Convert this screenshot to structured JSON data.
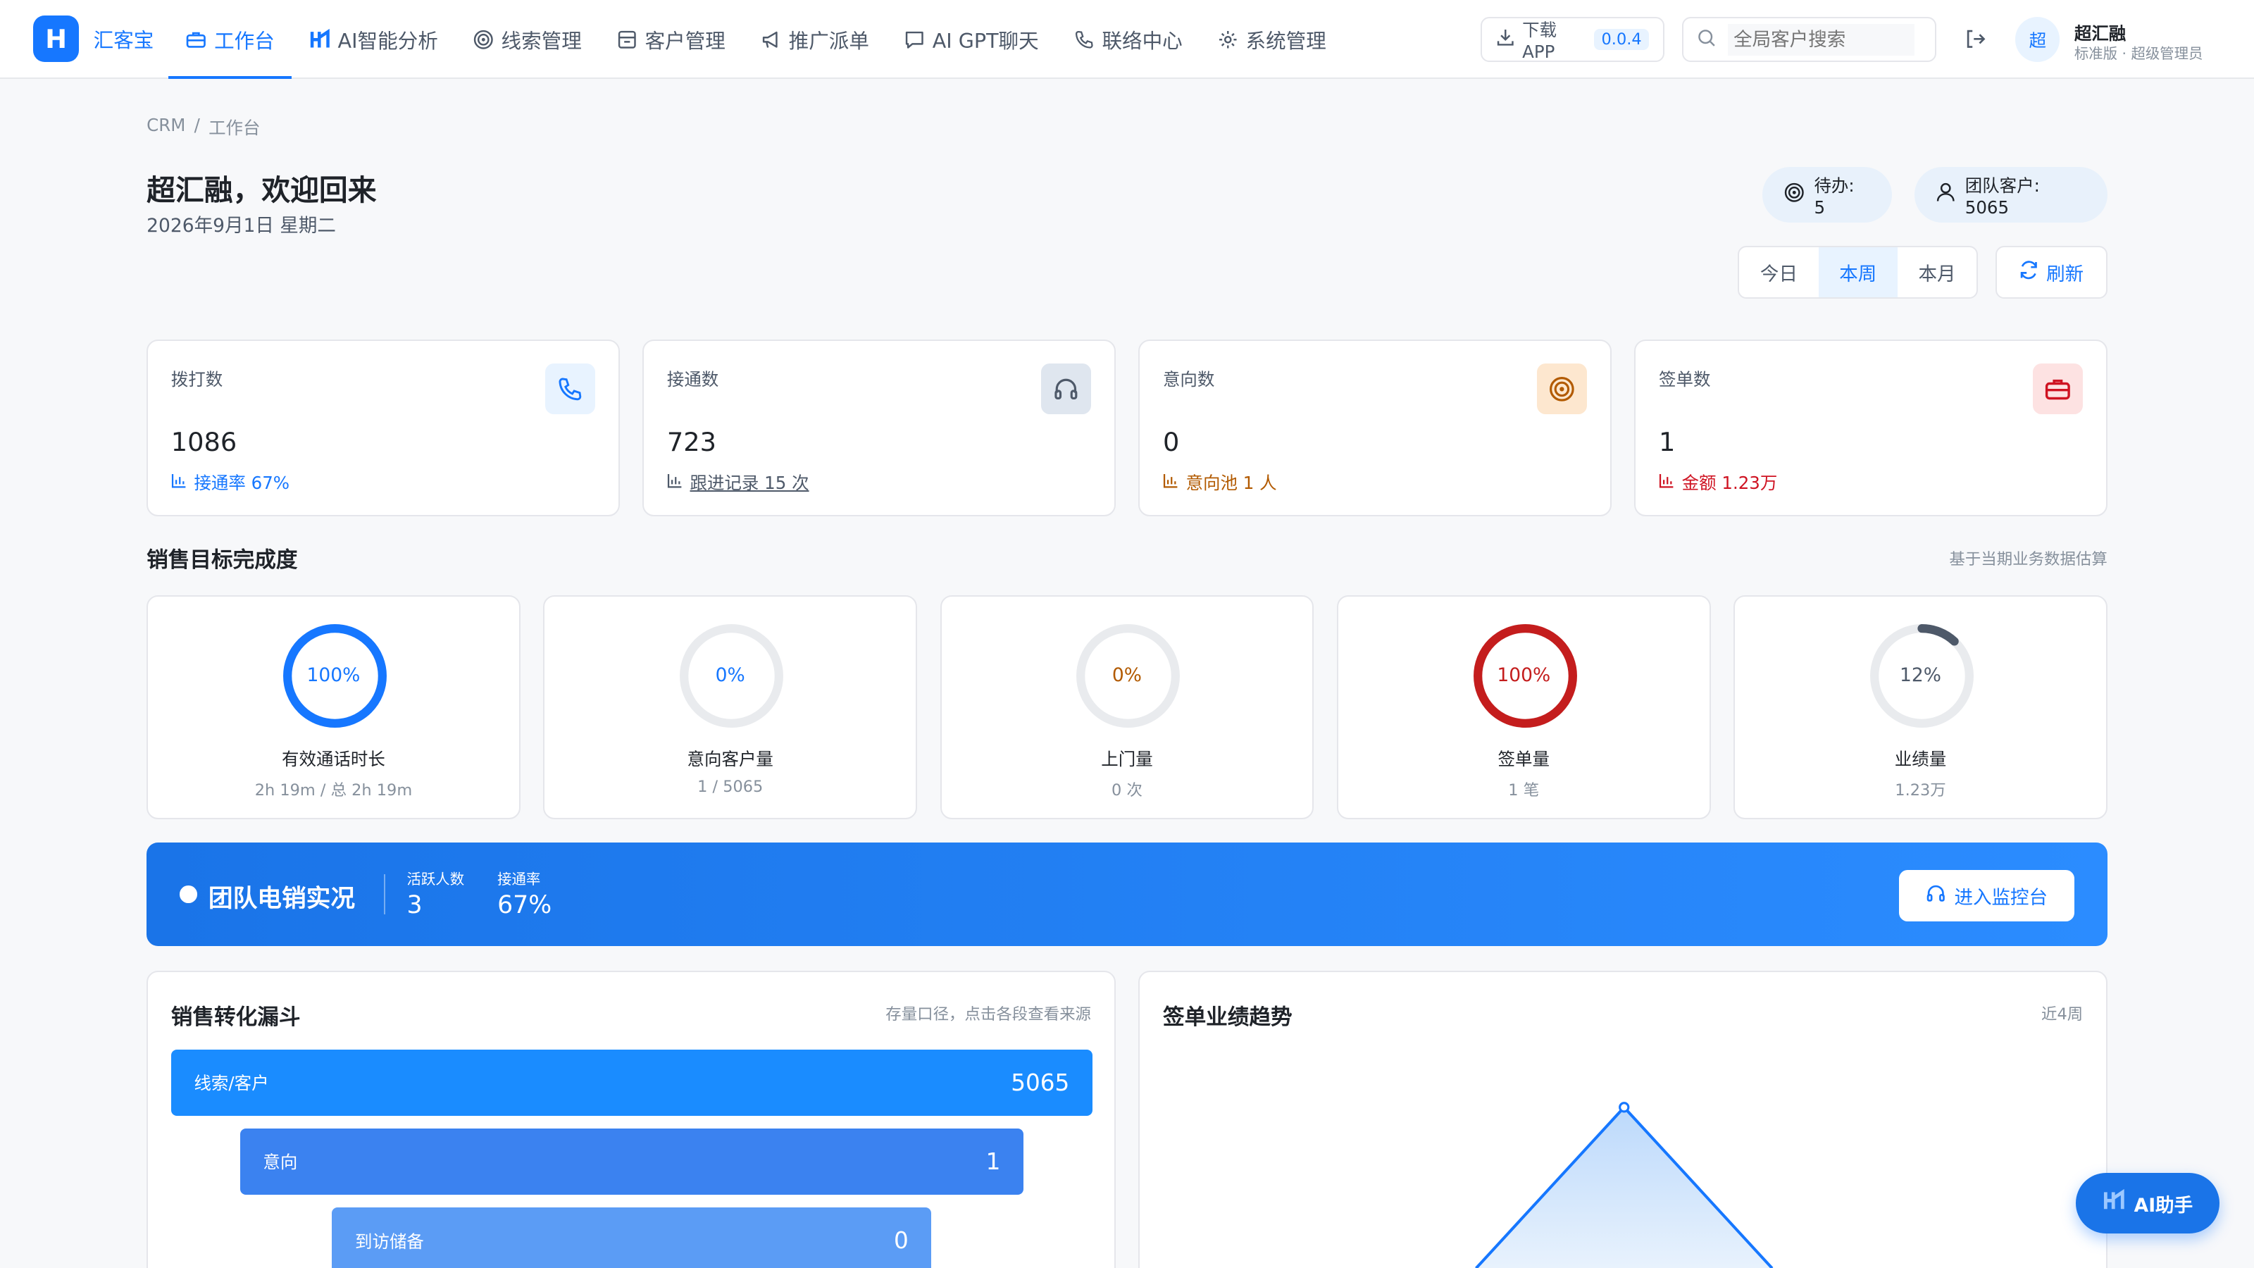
{
  "header": {
    "brand": "汇客宝",
    "logo_text": "H",
    "nav": [
      {
        "label": "工作台",
        "icon": "briefcase-icon"
      },
      {
        "label": "AI智能分析",
        "icon": "ai-logo-icon"
      },
      {
        "label": "线索管理",
        "icon": "target-icon"
      },
      {
        "label": "客户管理",
        "icon": "inbox-icon"
      },
      {
        "label": "推广派单",
        "icon": "megaphone-icon"
      },
      {
        "label": "AI GPT聊天",
        "icon": "chat-icon"
      },
      {
        "label": "联络中心",
        "icon": "phone-icon"
      },
      {
        "label": "系统管理",
        "icon": "gear-icon"
      }
    ],
    "download_label": "下载APP",
    "version": "0.0.4",
    "search_placeholder": "全局客户搜索",
    "avatar_text": "超",
    "user_name": "超汇融",
    "user_role": "标准版 · 超级管理员"
  },
  "breadcrumb": {
    "root": "CRM",
    "sep": "/",
    "current": "工作台"
  },
  "greeting": "超汇融，欢迎回来",
  "date": "2026年9月1日 星期二",
  "pills": {
    "todo": "待办: 5",
    "team": "团队客户: 5065"
  },
  "range_tabs": [
    "今日",
    "本周",
    "本月"
  ],
  "refresh_label": "刷新",
  "stats": [
    {
      "label": "拨打数",
      "value": "1086",
      "sub": "接通率 67%",
      "color": "#1677ff",
      "bg": "#e8f3ff"
    },
    {
      "label": "接通数",
      "value": "723",
      "sub": "跟进记录 15 次",
      "color": "#4e5969",
      "bg": "#dfe6ef"
    },
    {
      "label": "意向数",
      "value": "0",
      "sub": "意向池 1 人",
      "color": "#b25a00",
      "bg": "#fde7cf"
    },
    {
      "label": "签单数",
      "value": "1",
      "sub": "金额 1.23万",
      "color": "#cf1322",
      "bg": "#fde2e2"
    }
  ],
  "goals": {
    "title": "销售目标完成度",
    "note": "基于当期业务数据估算",
    "items": [
      {
        "pct": "100%",
        "label": "有效通话时长",
        "sub": "2h 19m / 总 2h 19m",
        "ratio": 1.0,
        "color": "#1677ff"
      },
      {
        "pct": "0%",
        "label": "意向客户量",
        "sub": "1 / 5065",
        "ratio": 0.0,
        "color": "#1677ff"
      },
      {
        "pct": "0%",
        "label": "上门量",
        "sub": "0 次",
        "ratio": 0.0,
        "color": "#b25a00"
      },
      {
        "pct": "100%",
        "label": "签单量",
        "sub": "1 笔",
        "ratio": 1.0,
        "color": "#c41d1d"
      },
      {
        "pct": "12%",
        "label": "业绩量",
        "sub": "1.23万",
        "ratio": 0.12,
        "color": "#4e5969"
      }
    ]
  },
  "banner": {
    "title": "团队电销实况",
    "active_label": "活跃人数",
    "active_value": "3",
    "rate_label": "接通率",
    "rate_value": "67%",
    "button": "进入监控台"
  },
  "funnel": {
    "title": "销售转化漏斗",
    "note": "存量口径，点击各段查看来源",
    "bars": [
      {
        "label": "线索/客户",
        "value": "5065",
        "color": "#1a8cff"
      },
      {
        "label": "意向",
        "value": "1",
        "color": "#3b82f0"
      },
      {
        "label": "到访储备",
        "value": "0",
        "color": "#5b9cf5"
      }
    ]
  },
  "trend": {
    "title": "签单业绩趋势",
    "note": "近4周"
  },
  "ai_button": "AI助手"
}
